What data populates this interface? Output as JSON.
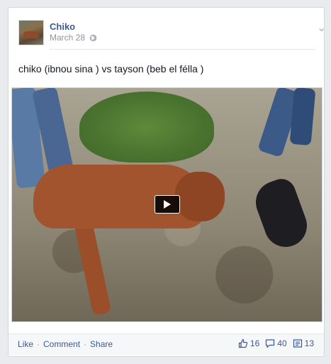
{
  "post": {
    "author": "Chiko",
    "date": "March 28",
    "privacy_icon": "globe-icon",
    "text": "chiko (ibnou sina ) vs tayson (beb el félla )"
  },
  "video": {
    "play_icon": "play-icon"
  },
  "footer": {
    "like_label": "Like",
    "comment_label": "Comment",
    "share_label": "Share",
    "separator": "·",
    "likes_count": "16",
    "comments_count": "40",
    "shares_count": "13"
  },
  "colors": {
    "link": "#3b5998",
    "muted": "#90949c",
    "background": "#e9ebee"
  }
}
